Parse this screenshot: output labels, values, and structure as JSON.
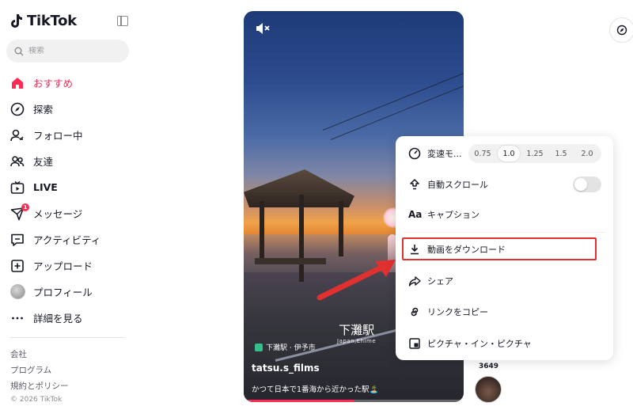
{
  "app": {
    "name": "TikTok"
  },
  "search": {
    "placeholder": "検索"
  },
  "nav": {
    "items": [
      {
        "label": "おすすめ",
        "icon": "home-icon",
        "active": true
      },
      {
        "label": "探索",
        "icon": "compass-icon"
      },
      {
        "label": "フォロー中",
        "icon": "following-icon"
      },
      {
        "label": "友達",
        "icon": "friends-icon"
      },
      {
        "label": "LIVE",
        "icon": "live-icon"
      },
      {
        "label": "メッセージ",
        "icon": "message-icon",
        "badge": "1"
      },
      {
        "label": "アクティビティ",
        "icon": "activity-icon"
      },
      {
        "label": "アップロード",
        "icon": "upload-icon"
      },
      {
        "label": "プロフィール",
        "icon": "avatar"
      },
      {
        "label": "詳細を見る",
        "icon": "more-icon"
      }
    ]
  },
  "footer": {
    "links": [
      "会社",
      "プログラム",
      "規約とポリシー"
    ],
    "copyright": "© 2026 TikTok"
  },
  "video": {
    "station_name": "下灘駅",
    "station_sub": "Japan,Ehime",
    "location": "下灘駅 · 伊予市",
    "author": "tatsu.s_films",
    "caption": "かつて日本で1番海から近かった駅🏝️",
    "progress": 0.5
  },
  "menu": {
    "speed_label": "変速モ...",
    "speeds": [
      "0.75",
      "1.0",
      "1.25",
      "1.5",
      "2.0"
    ],
    "selected_speed": "1.0",
    "autoscroll_label": "自動スクロール",
    "autoscroll_on": false,
    "caption_label": "キャプション",
    "download_label": "動画をダウンロード",
    "share_label": "シェア",
    "copy_link_label": "リンクをコピー",
    "pip_label": "ピクチャ・イン・ピクチャ"
  },
  "side": {
    "count": "3649"
  },
  "colors": {
    "accent": "#fe2c55",
    "highlight": "#e0302f"
  }
}
